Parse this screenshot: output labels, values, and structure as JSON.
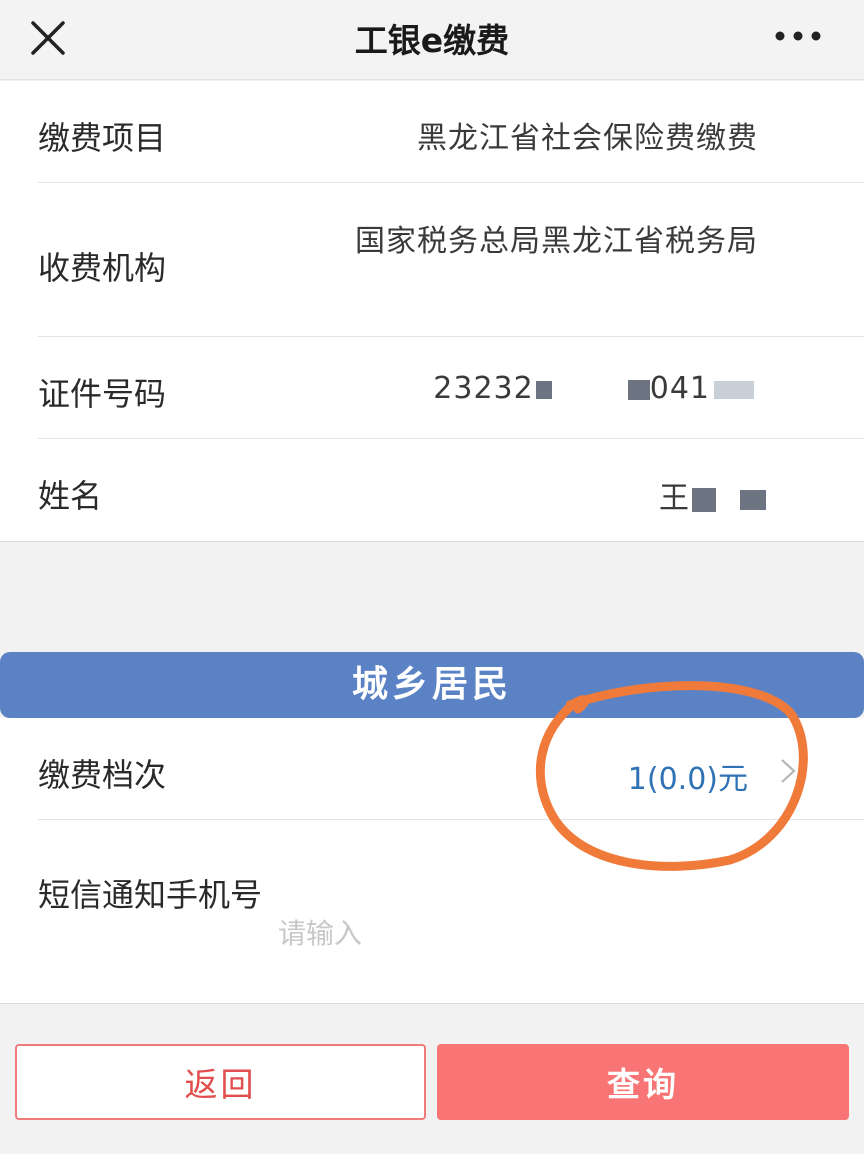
{
  "header": {
    "title": "工银e缴费",
    "close_icon": "close-icon",
    "more_icon": "more-icon"
  },
  "info": {
    "item": {
      "label": "缴费项目",
      "value": "黑龙江省社会保险费缴费"
    },
    "agency": {
      "label": "收费机构",
      "value": "国家税务总局黑龙江省税务局"
    },
    "id_number": {
      "label": "证件号码",
      "value_prefix": "23232",
      "value_suffix": "041"
    },
    "name": {
      "label": "姓名",
      "value_prefix": "王"
    }
  },
  "banner": {
    "label": "城乡居民"
  },
  "tier": {
    "label": "缴费档次",
    "value": "1(0.0)元",
    "chevron_icon": "chevron-right-icon"
  },
  "phone": {
    "label": "短信通知手机号",
    "placeholder": "请输入"
  },
  "buttons": {
    "back": "返回",
    "query": "查询"
  },
  "colors": {
    "banner": "#5b82c5",
    "tier_value": "#2f72b6",
    "back_text": "#e24d4d",
    "query_bg": "#f97474",
    "annotation": "#f07a3a"
  }
}
